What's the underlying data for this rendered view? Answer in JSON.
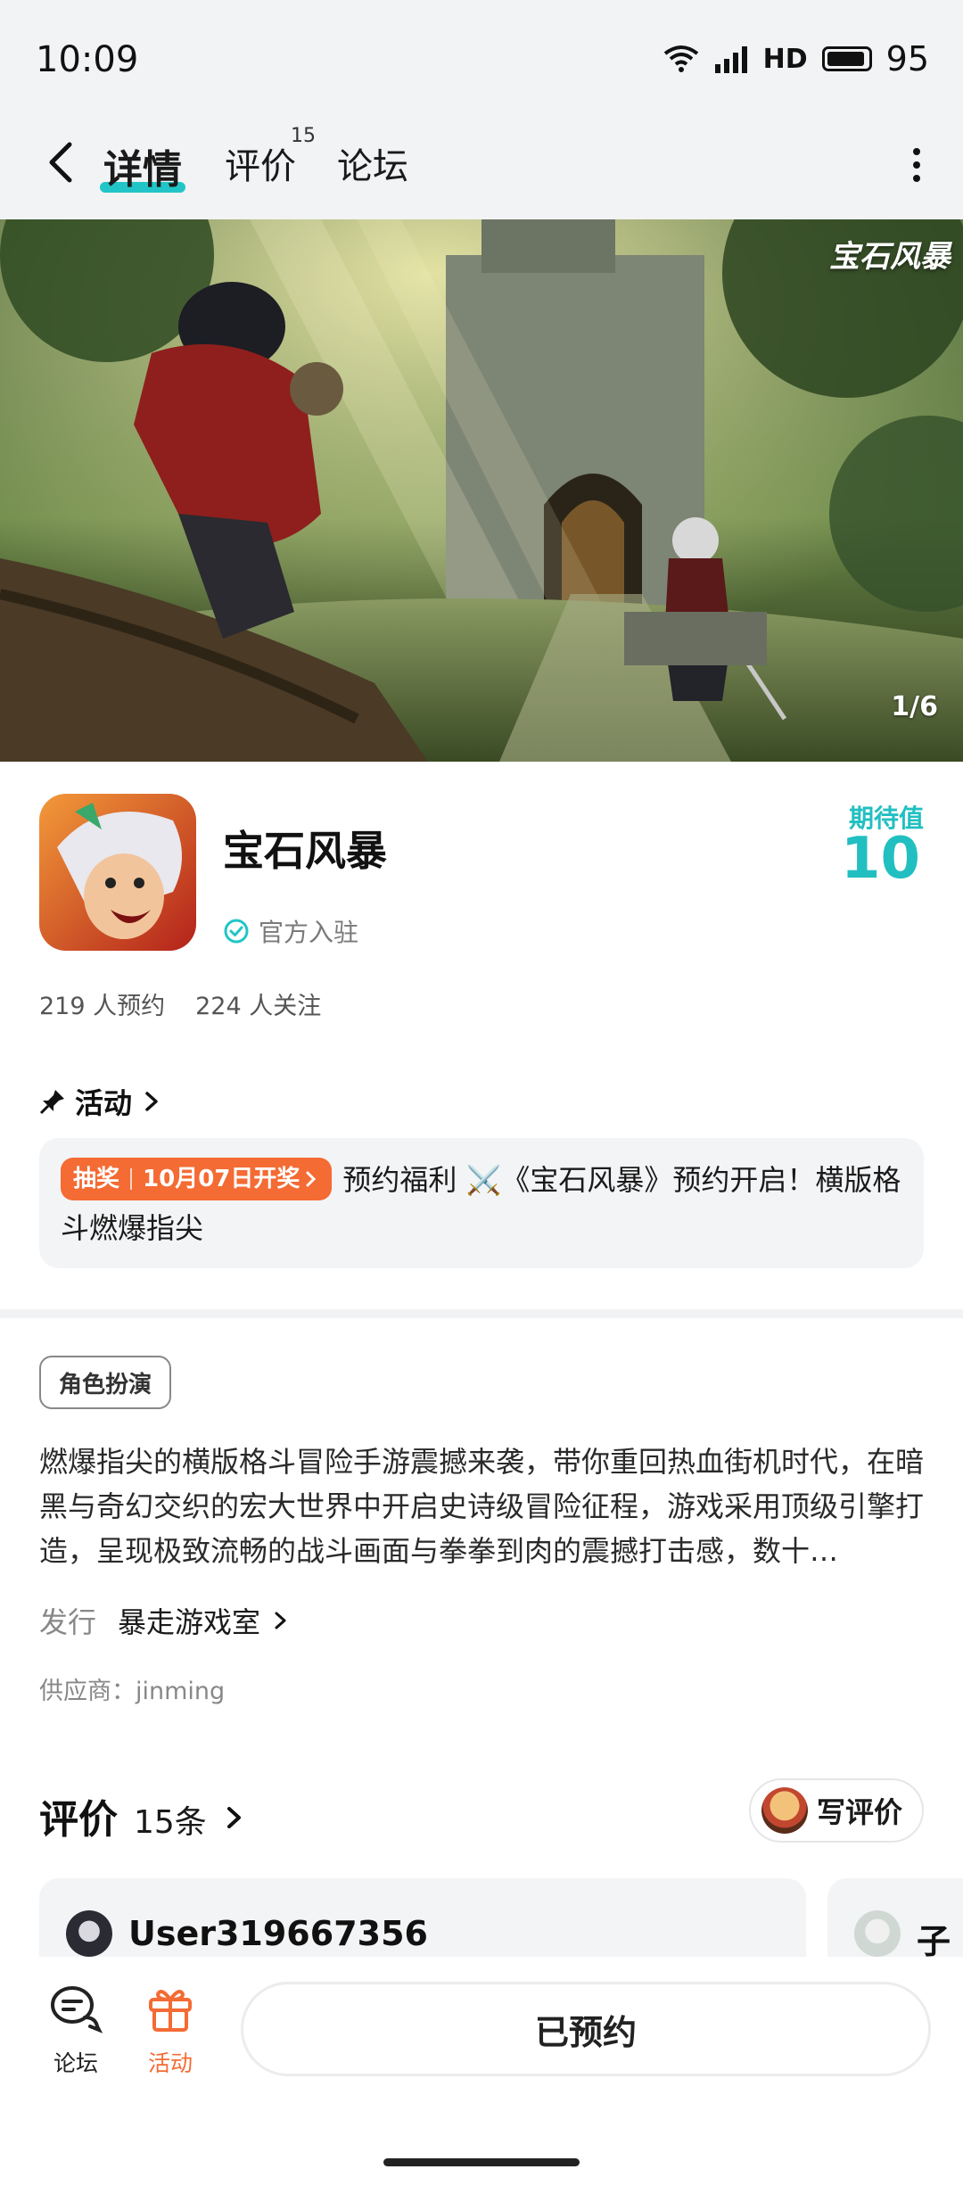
{
  "status_bar": {
    "time": "10:09",
    "network": "HD",
    "battery": "95",
    "battery_level": 0.95
  },
  "nav": {
    "tabs": [
      {
        "label": "详情",
        "active": true
      },
      {
        "label": "评价",
        "count": "15"
      },
      {
        "label": "论坛"
      }
    ]
  },
  "hero": {
    "counter": "1/6",
    "logo_text": "宝石风暴"
  },
  "game": {
    "title": "宝石风暴",
    "official_label": "官方入驻",
    "expect_label": "期待值",
    "expect_value": "10",
    "reservations": "219 人预约",
    "followers": "224 人关注"
  },
  "activity": {
    "header": "活动",
    "tag_type": "抽奖",
    "tag_date": "10月07日开奖",
    "text": "预约福利 ⚔️《宝石风暴》预约开启！横版格斗燃爆指尖"
  },
  "details": {
    "genre": "角色扮演",
    "description": "燃爆指尖的横版格斗冒险手游震撼来袭，带你重回热血街机时代，在暗黑与奇幻交织的宏大世界中开启史诗级冒险征程，游戏采用顶级引擎打造，呈现极致流畅的战斗画面与拳拳到肉的震撼打击感，数十…",
    "publisher_label": "发行",
    "publisher": "暴走游戏室",
    "supplier": "供应商：jinming"
  },
  "reviews": {
    "title": "评价",
    "count": "15条",
    "write_label": "写评价",
    "cards": [
      {
        "user": "User319667356"
      },
      {
        "user": "子"
      }
    ]
  },
  "bottom_bar": {
    "forum_label": "论坛",
    "activity_label": "活动",
    "reserve_label": "已预约",
    "accent": "#f46b34"
  },
  "colors": {
    "accent_teal": "#22c5c7",
    "lottery_orange": "#f46b34"
  }
}
